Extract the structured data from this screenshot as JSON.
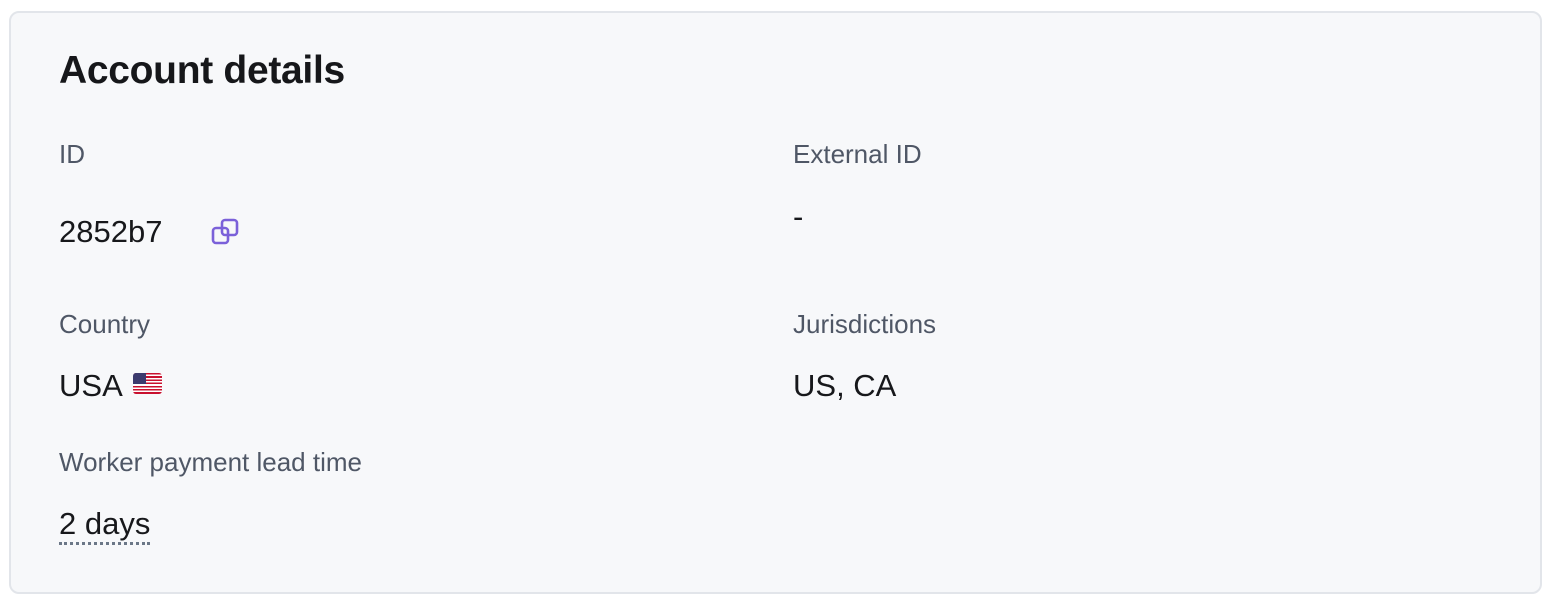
{
  "card": {
    "title": "Account details"
  },
  "fields": {
    "id": {
      "label": "ID",
      "value": "2852b7"
    },
    "external_id": {
      "label": "External ID",
      "value": "-"
    },
    "country": {
      "label": "Country",
      "value": "USA"
    },
    "jurisdictions": {
      "label": "Jurisdictions",
      "value": "US, CA"
    },
    "lead_time": {
      "label": "Worker payment lead time",
      "value": "2 days"
    }
  },
  "icons": {
    "copy": "copy-icon",
    "flag": "us-flag-icon"
  },
  "colors": {
    "card_background": "#f7f8fa",
    "card_border": "#e2e5ea",
    "label": "#4f5766",
    "value": "#17181b",
    "copy_icon": "#7b61d9"
  }
}
